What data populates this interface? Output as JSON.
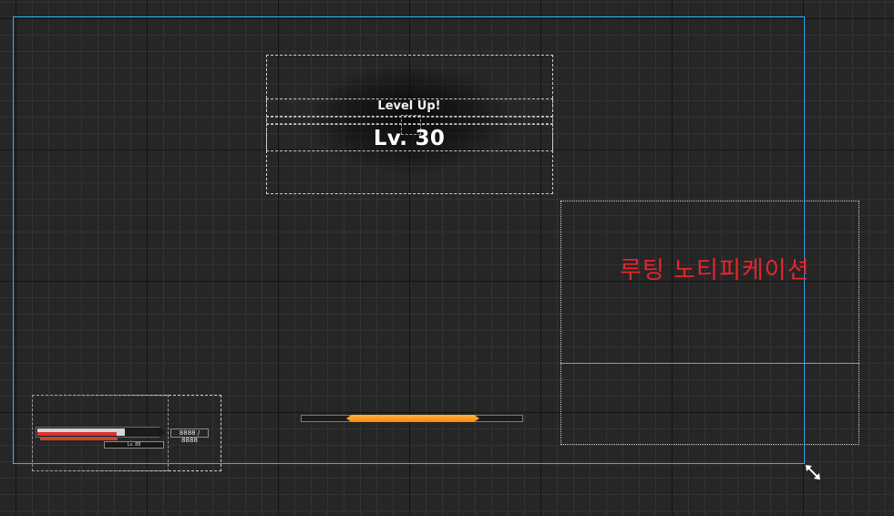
{
  "levelup": {
    "title": "Level Up!",
    "level": "Lv. 30"
  },
  "looting": {
    "label": "루팅 노티피케이션"
  },
  "hud": {
    "hp_text": "8888 / 8888",
    "level_tag": "Lv. 88",
    "hp_ratio": 0.65
  },
  "exp": {
    "fill_ratio": 0.6
  },
  "colors": {
    "canvas_border": "#2ab3ff",
    "looting_text": "#e5262b",
    "exp_fill": "#ff8a00",
    "hp_red": "#e13131"
  },
  "icons": {
    "resize": "resize-diagonal-icon"
  }
}
